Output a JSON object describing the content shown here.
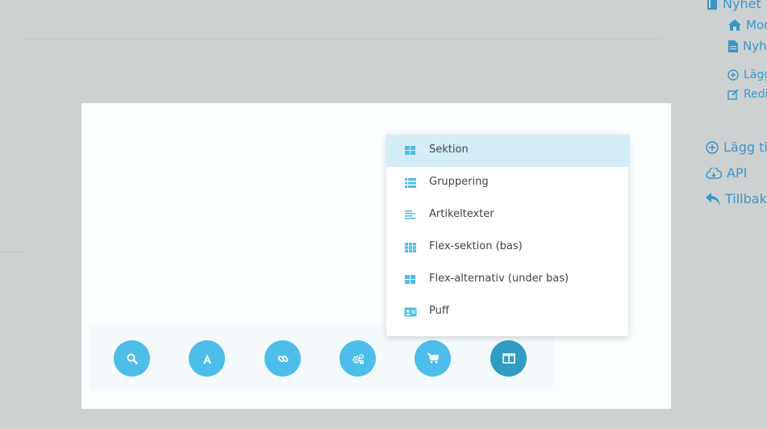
{
  "sidebar": {
    "items": [
      {
        "label": "Nyhet",
        "icon": "book-icon"
      },
      {
        "label": "Mod",
        "icon": "home-icon"
      },
      {
        "label": "Nyh",
        "icon": "document-icon"
      },
      {
        "label": "Lägg",
        "icon": "plus-circle-icon"
      },
      {
        "label": "Redig",
        "icon": "edit-icon"
      },
      {
        "label": "Lägg ti",
        "icon": "plus-circle-icon"
      },
      {
        "label": "API",
        "icon": "cloud-download-icon"
      },
      {
        "label": "Tillbak",
        "icon": "reply-icon"
      }
    ]
  },
  "dropdown": {
    "items": [
      {
        "label": "Sektion",
        "icon": "grid-2x2-icon",
        "selected": true
      },
      {
        "label": "Gruppering",
        "icon": "list-icon"
      },
      {
        "label": "Artikeltexter",
        "icon": "align-left-icon"
      },
      {
        "label": "Flex-sektion (bas)",
        "icon": "grid-3x3-icon"
      },
      {
        "label": "Flex-alternativ (under bas)",
        "icon": "grid-2x2-icon"
      },
      {
        "label": "Puff",
        "icon": "id-card-icon"
      }
    ]
  },
  "toolbar": {
    "buttons": [
      {
        "icon": "search-icon"
      },
      {
        "icon": "font-icon"
      },
      {
        "icon": "link-icon"
      },
      {
        "icon": "cogs-icon"
      },
      {
        "icon": "cart-icon"
      },
      {
        "icon": "columns-icon",
        "active": true
      }
    ]
  },
  "colors": {
    "accent": "#4dbde9",
    "accent_active": "#2f9cc6",
    "link": "#3a95c8",
    "selected_bg": "#d4ecf5",
    "backdrop": "#cdd1d2"
  }
}
